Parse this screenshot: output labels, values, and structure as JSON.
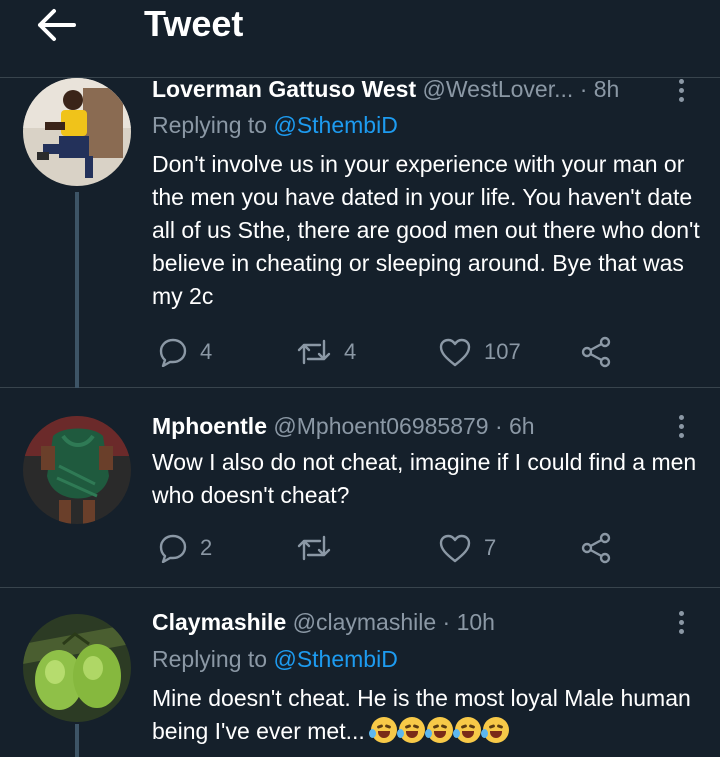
{
  "header": {
    "title": "Tweet",
    "back_icon": "arrow-left-icon"
  },
  "tweets": [
    {
      "display_name": "Loverman Gattuso West",
      "handle": "@WestLover...",
      "time": "· 8h",
      "replying_prefix": "Replying to",
      "replying_to": "@SthembiD",
      "text": "Don't involve us in your experience with your man or the men you have dated in your life. You haven't date all of us Sthe, there are good men out there who don't believe in cheating or sleeping around. Bye that was my 2c",
      "replies": "4",
      "retweets": "4",
      "likes": "107"
    },
    {
      "display_name": "Mphoentle",
      "handle": "@Mphoent06985879",
      "time": "· 6h",
      "text": "Wow I also do not cheat, imagine if I could find a men who doesn't cheat?",
      "replies": "2",
      "retweets": "",
      "likes": "7"
    },
    {
      "display_name": "Claymashile",
      "handle": "@claymashile",
      "time": "· 10h",
      "replying_prefix": "Replying to",
      "replying_to": "@SthembiD",
      "text": "Mine doesn't cheat. He is the most loyal Male human being I've ever met...",
      "emoji": "rolling-on-floor-laughing-emoji",
      "emoji_count": 5
    }
  ],
  "colors": {
    "background": "#15202b",
    "accent": "#1d9bf0",
    "secondary_text": "#8b98a5",
    "divider": "#38444d"
  }
}
